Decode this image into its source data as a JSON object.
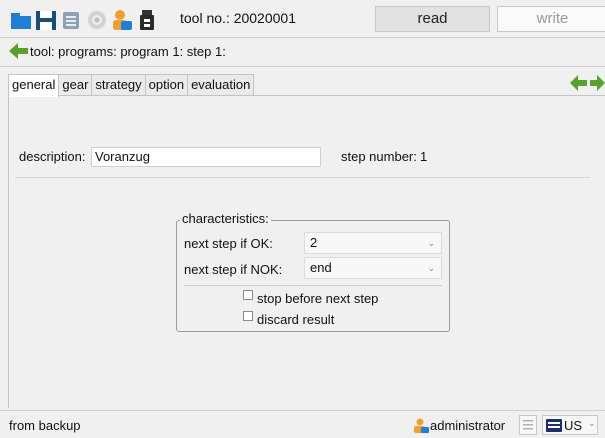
{
  "toolbar": {
    "tool_label": "tool no.: 20020001",
    "read_label": "read",
    "write_label": "write",
    "icons": [
      "folder-icon",
      "save-icon",
      "print-icon",
      "settings-icon",
      "user-icon",
      "usb-icon"
    ]
  },
  "breadcrumb": {
    "text": "tool: programs: program 1: step 1:"
  },
  "tabs": [
    {
      "label": "general",
      "active": true
    },
    {
      "label": "gear",
      "active": false
    },
    {
      "label": "strategy",
      "active": false
    },
    {
      "label": "option",
      "active": false
    },
    {
      "label": "evaluation",
      "active": false
    }
  ],
  "form": {
    "description_label": "description:",
    "description_value": "Voranzug",
    "step_number_label": "step number:",
    "step_number_value": "1"
  },
  "characteristics": {
    "title": "characteristics:",
    "next_ok_label": "next step if OK:",
    "next_ok_value": "2",
    "next_nok_label": "next step if NOK:",
    "next_nok_value": "end",
    "stop_before_label": "stop before next step",
    "stop_before_checked": false,
    "discard_label": "discard result",
    "discard_checked": false
  },
  "status": {
    "left_text": "from backup",
    "user": "administrator",
    "language": "US"
  },
  "colors": {
    "accent_blue": "#1f7fd6",
    "green_arrow": "#5aa02c",
    "orange_user": "#f0a030"
  }
}
